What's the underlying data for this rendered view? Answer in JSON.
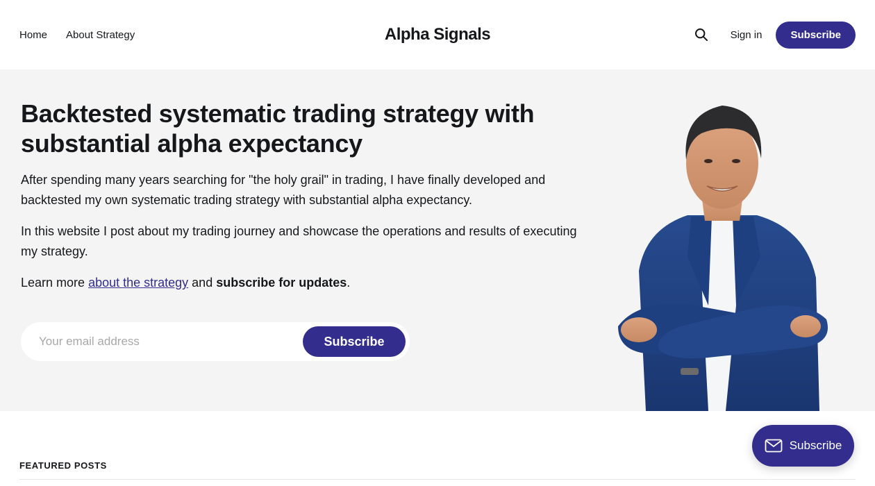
{
  "header": {
    "nav": [
      {
        "label": "Home"
      },
      {
        "label": "About Strategy"
      }
    ],
    "brand": "Alpha Signals",
    "search_icon": "search-icon",
    "signin_label": "Sign in",
    "subscribe_label": "Subscribe"
  },
  "hero": {
    "title": "Backtested systematic trading strategy with substantial alpha expectancy",
    "paragraph1": "After spending many years searching for \"the holy grail\" in trading, I have finally developed and backtested my own systematic trading strategy with substantial alpha expectancy.",
    "paragraph2": "In this website I post about my trading journey and showcase the operations and results of executing my strategy.",
    "learn_prefix": "Learn more ",
    "learn_link": "about the strategy",
    "learn_mid": " and ",
    "learn_bold": "subscribe for updates",
    "learn_suffix": ".",
    "email_placeholder": "Your email address",
    "subscribe_label": "Subscribe"
  },
  "featured": {
    "heading": "FEATURED POSTS"
  },
  "portal": {
    "icon": "mail-icon",
    "label": "Subscribe"
  },
  "colors": {
    "accent": "#332d8e",
    "hero_bg": "#f4f4f4",
    "text": "#15171a"
  }
}
